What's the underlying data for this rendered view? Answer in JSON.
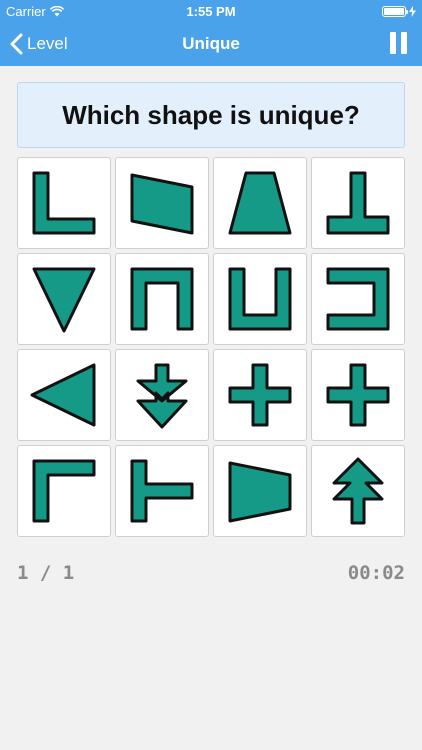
{
  "status_bar": {
    "carrier": "Carrier",
    "time": "1:55 PM",
    "wifi_icon": "wifi-icon",
    "battery_icon": "battery-icon",
    "charging_icon": "charging-bolt-icon"
  },
  "nav": {
    "back_label": "Level",
    "back_icon": "chevron-left-icon",
    "title": "Unique",
    "pause_icon": "pause-icon"
  },
  "question": "Which shape is unique?",
  "shape_fill": "#169a88",
  "shape_stroke": "#111111",
  "tiles": [
    "l-shape",
    "parallelogram-quad",
    "trapezoid",
    "inverted-t-shape",
    "down-triangle",
    "n-bracket",
    "u-bracket",
    "right-bracket",
    "left-triangle",
    "down-arrow",
    "plus-cross",
    "plus-cross",
    "corner-bracket",
    "t-sideways",
    "right-trapezoid",
    "up-arrow"
  ],
  "progress": "1 / 1",
  "timer": "00:02"
}
